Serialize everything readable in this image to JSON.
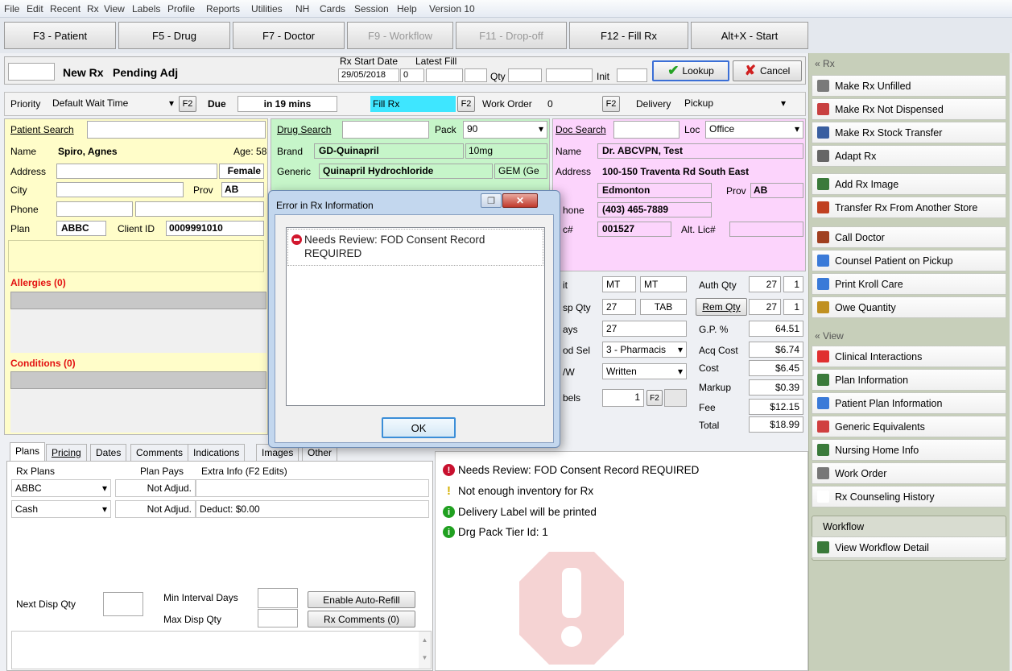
{
  "menu": [
    "File",
    "Edit",
    "Recent",
    "Rx",
    "View",
    "Labels",
    "Profile",
    "Reports",
    "Utilities",
    "NH",
    "Cards",
    "Session",
    "Help",
    "Version 10"
  ],
  "fkeys": [
    {
      "label": "F3 - Patient",
      "enabled": true
    },
    {
      "label": "F5 - Drug",
      "enabled": true
    },
    {
      "label": "F7 - Doctor",
      "enabled": true
    },
    {
      "label": "F9 - Workflow",
      "enabled": false
    },
    {
      "label": "F11 - Drop-off",
      "enabled": false
    },
    {
      "label": "F12 - Fill Rx",
      "enabled": true
    },
    {
      "label": "Alt+X - Start",
      "enabled": true
    }
  ],
  "header": {
    "new_rx": "New Rx",
    "status": "Pending Adj",
    "rx_start_label": "Rx Start Date",
    "rx_start_value": "29/05/2018",
    "rx_start_num": "0",
    "latest_fill_label": "Latest Fill",
    "qty_label": "Qty",
    "init_label": "Init",
    "lookup": "Lookup",
    "cancel": "Cancel"
  },
  "priority": {
    "label": "Priority",
    "value": "Default Wait Time",
    "f2": "F2",
    "due_label": "Due",
    "due_value": "in 19 mins",
    "fill_rx": "Fill Rx",
    "work_order_label": "Work Order",
    "work_order_value": "0",
    "delivery_label": "Delivery",
    "delivery_value": "Pickup"
  },
  "patient": {
    "search_label": "Patient Search",
    "name_label": "Name",
    "name": "Spiro, Agnes",
    "age": "Age: 58",
    "address_label": "Address",
    "gender": "Female",
    "city_label": "City",
    "prov_label": "Prov",
    "prov": "AB",
    "phone_label": "Phone",
    "plan_label": "Plan",
    "plan": "ABBC",
    "client_id_label": "Client ID",
    "client_id": "0009991010",
    "allergies": "Allergies (0)",
    "conditions": "Conditions (0)"
  },
  "drug": {
    "search_label": "Drug Search",
    "pack_label": "Pack",
    "pack": "90",
    "brand_label": "Brand",
    "brand": "GD-Quinapril",
    "strength": "10mg",
    "generic_label": "Generic",
    "generic": "Quinapril Hydrochloride",
    "gem": "GEM (Ge"
  },
  "doctor": {
    "search_label": "Doc Search",
    "loc_label": "Loc",
    "loc": "Office",
    "name_label": "Name",
    "name": "Dr. ABCVPN, Test",
    "address_label": "Address",
    "address": "100-150 Traventa Rd South East",
    "city": "Edmonton",
    "prov_label": "Prov",
    "prov": "AB",
    "phone_label": "hone",
    "phone": "(403) 465-7889",
    "lic_label": "c#",
    "lic": "001527",
    "alt_lic_label": "Alt. Lic#"
  },
  "qty": {
    "unit_label": "it",
    "unit1": "MT",
    "unit2": "MT",
    "auth_qty_label": "Auth Qty",
    "auth_qty": "27",
    "auth_qty2": "1",
    "disp_qty_label": "sp Qty",
    "disp_qty": "27",
    "disp_form": "TAB",
    "rem_qty_label": "Rem Qty",
    "rem_qty": "27",
    "rem_qty2": "1",
    "days_label": "ays",
    "days": "27",
    "gp_label": "G.P. %",
    "gp": "64.51",
    "method_label": "od Sel",
    "method": "3 - Pharmacis",
    "acq_label": "Acq Cost",
    "acq": "$6.74",
    "sw_label": "/W",
    "sw": "Written",
    "cost_label": "Cost",
    "cost": "$6.45",
    "markup_label": "Markup",
    "markup": "$0.39",
    "labels_label": "bels",
    "labels_count": "1",
    "f2": "F2",
    "fee_label": "Fee",
    "fee": "$12.15",
    "total_label": "Total",
    "total": "$18.99"
  },
  "tabs": [
    "Plans",
    "Pricing",
    "Dates",
    "Comments",
    "Indications",
    "Images",
    "Other"
  ],
  "plans": {
    "col1": "Rx Plans",
    "col2": "Plan Pays",
    "col3": "Extra Info (F2 Edits)",
    "rows": [
      {
        "plan": "ABBC",
        "pays": "Not Adjud.",
        "info": ""
      },
      {
        "plan": "Cash",
        "pays": "Not Adjud.",
        "info": "Deduct: $0.00"
      }
    ],
    "next_disp_label": "Next Disp Qty",
    "min_interval_label": "Min Interval Days",
    "max_disp_label": "Max Disp Qty",
    "auto_refill": "Enable Auto-Refill",
    "rx_comments": "Rx Comments (0)"
  },
  "messages": [
    {
      "type": "error",
      "text": "Needs Review: FOD Consent Record REQUIRED"
    },
    {
      "type": "warning",
      "text": "Not enough inventory for Rx"
    },
    {
      "type": "info",
      "text": "Delivery Label will be printed"
    },
    {
      "type": "info",
      "text": "Drg Pack Tier Id: 1"
    }
  ],
  "dialog": {
    "title": "Error in Rx Information",
    "message": "Needs Review: FOD Consent Record REQUIRED",
    "ok": "OK"
  },
  "right_panel": {
    "rx_header": "Rx",
    "rx_items": [
      "Make Rx Unfilled",
      "Make Rx Not Dispensed",
      "Make Rx Stock Transfer",
      "Adapt Rx",
      "Add Rx Image",
      "Transfer Rx From Another Store",
      "Call Doctor",
      "Counsel Patient on Pickup",
      "Print Kroll Care",
      "Owe Quantity"
    ],
    "view_header": "View",
    "view_items": [
      "Clinical Interactions",
      "Plan Information",
      "Patient Plan Information",
      "Generic Equivalents",
      "Nursing Home Info",
      "Work Order",
      "Rx Counseling History"
    ],
    "workflow_header": "Workflow",
    "workflow_items": [
      "View Workflow Detail"
    ]
  },
  "colors": {
    "error": "#c8102e",
    "warning": "#e8c400",
    "info": "#20a020",
    "fill_rx": "#3ee6ff"
  }
}
